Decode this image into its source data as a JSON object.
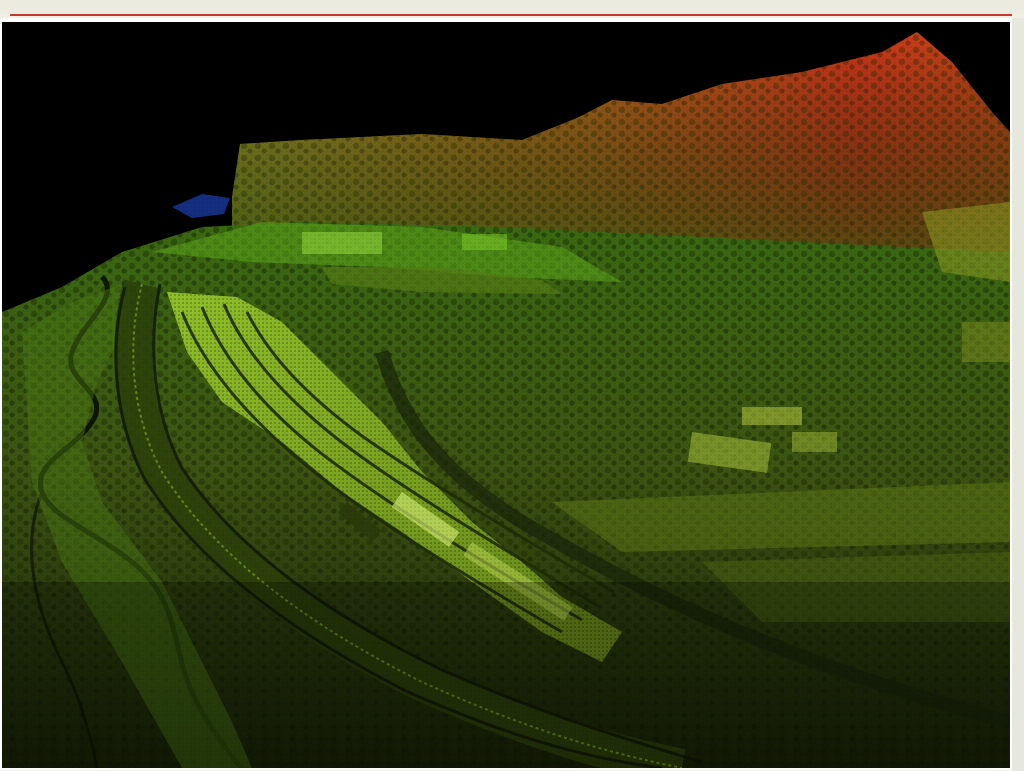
{
  "image": {
    "subject": "lidar-point-cloud",
    "color_scale": [
      "#1d3b0a",
      "#4d7d14",
      "#9acb2a",
      "#c8a42a",
      "#d0401a"
    ]
  },
  "colors": {
    "background": "#efefe6",
    "accent_rule": "#c9382f",
    "frame": "#ffffff"
  }
}
